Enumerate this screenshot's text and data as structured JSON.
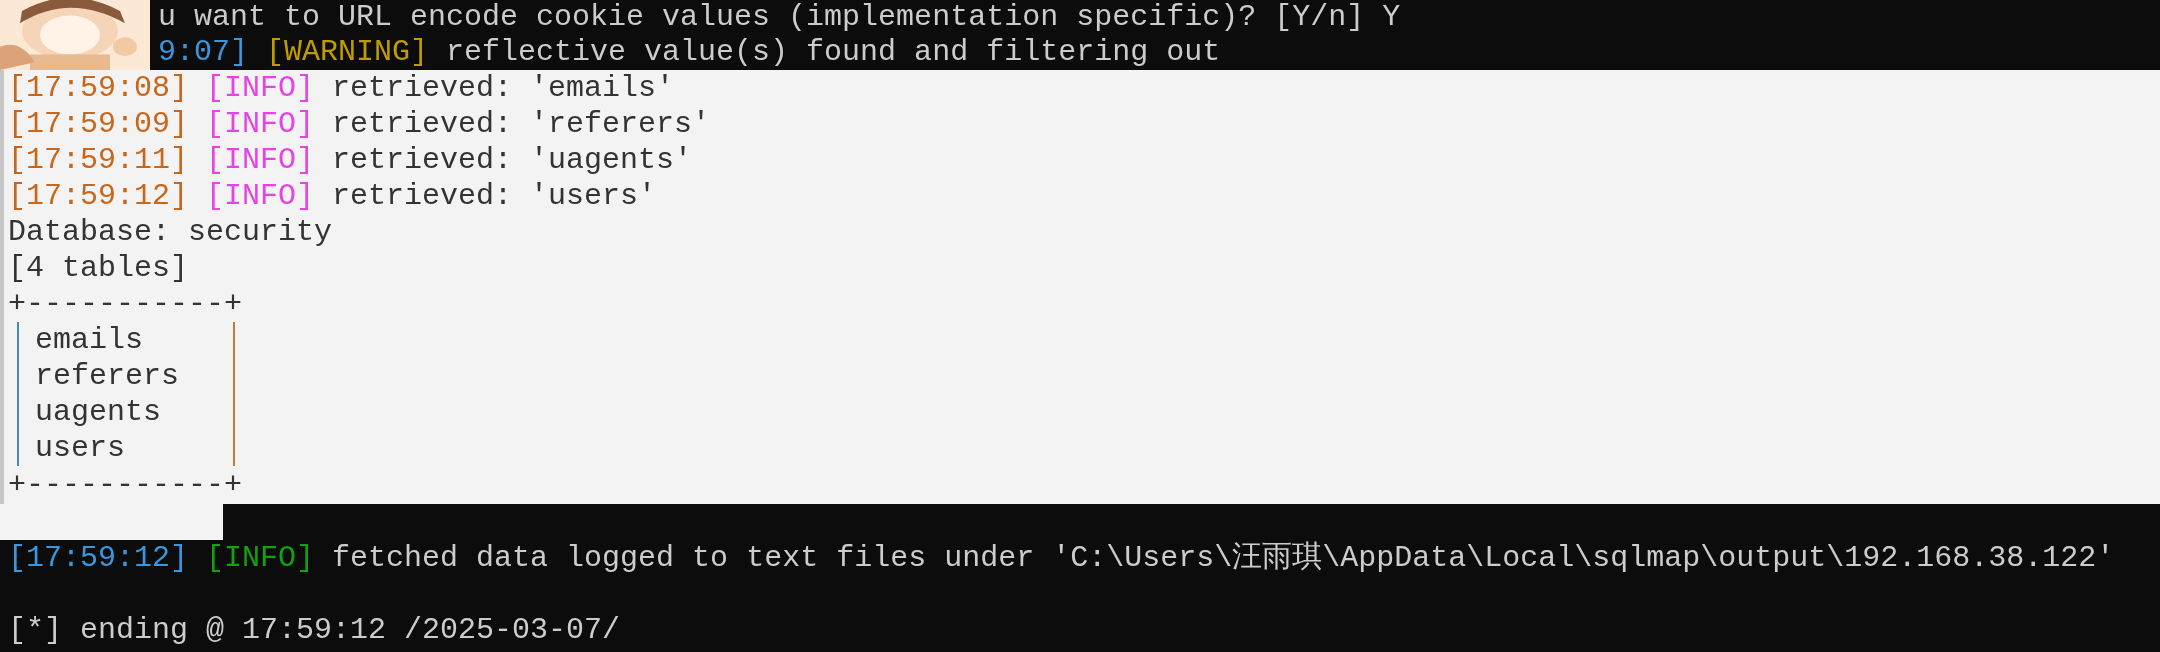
{
  "top_output": {
    "lines": [
      {
        "kind": "plain",
        "text": "u want to URL encode cookie values (implementation specific)? [Y/n] Y"
      },
      {
        "kind": "log",
        "time": "9:07]",
        "level": "[WARNING]",
        "color": "#c19c00",
        "message": "reflective value(s) found and filtering out"
      }
    ]
  },
  "light_output": {
    "log_lines": [
      {
        "time": "[17:59:08]",
        "level": "[INFO]",
        "color": "#e444e4",
        "message": "retrieved: 'emails'"
      },
      {
        "time": "[17:59:09]",
        "level": "[INFO]",
        "color": "#e444e4",
        "message": "retrieved: 'referers'"
      },
      {
        "time": "[17:59:11]",
        "level": "[INFO]",
        "color": "#e444e4",
        "message": "retrieved: 'uagents'"
      },
      {
        "time": "[17:59:12]",
        "level": "[INFO]",
        "color": "#e444e4",
        "message": "retrieved: 'users'"
      }
    ],
    "database_line": "Database: security",
    "table_count": "[4 tables]",
    "table": {
      "top_border": "+-----------+",
      "rows": [
        "emails",
        "referers",
        "uagents",
        "users"
      ],
      "bottom_border": "+-----------+"
    }
  },
  "bottom_output": {
    "lines": [
      {
        "kind": "log",
        "time": "[17:59:12]",
        "level": "[INFO]",
        "color": "#13a10e",
        "message": "fetched data logged to text files under 'C:\\Users\\汪雨琪\\AppData\\Local\\sqlmap\\output\\192.168.38.122'"
      },
      {
        "kind": "blank"
      },
      {
        "kind": "plain",
        "text": "[*] ending @ 17:59:12 /2025-03-07/"
      }
    ]
  }
}
